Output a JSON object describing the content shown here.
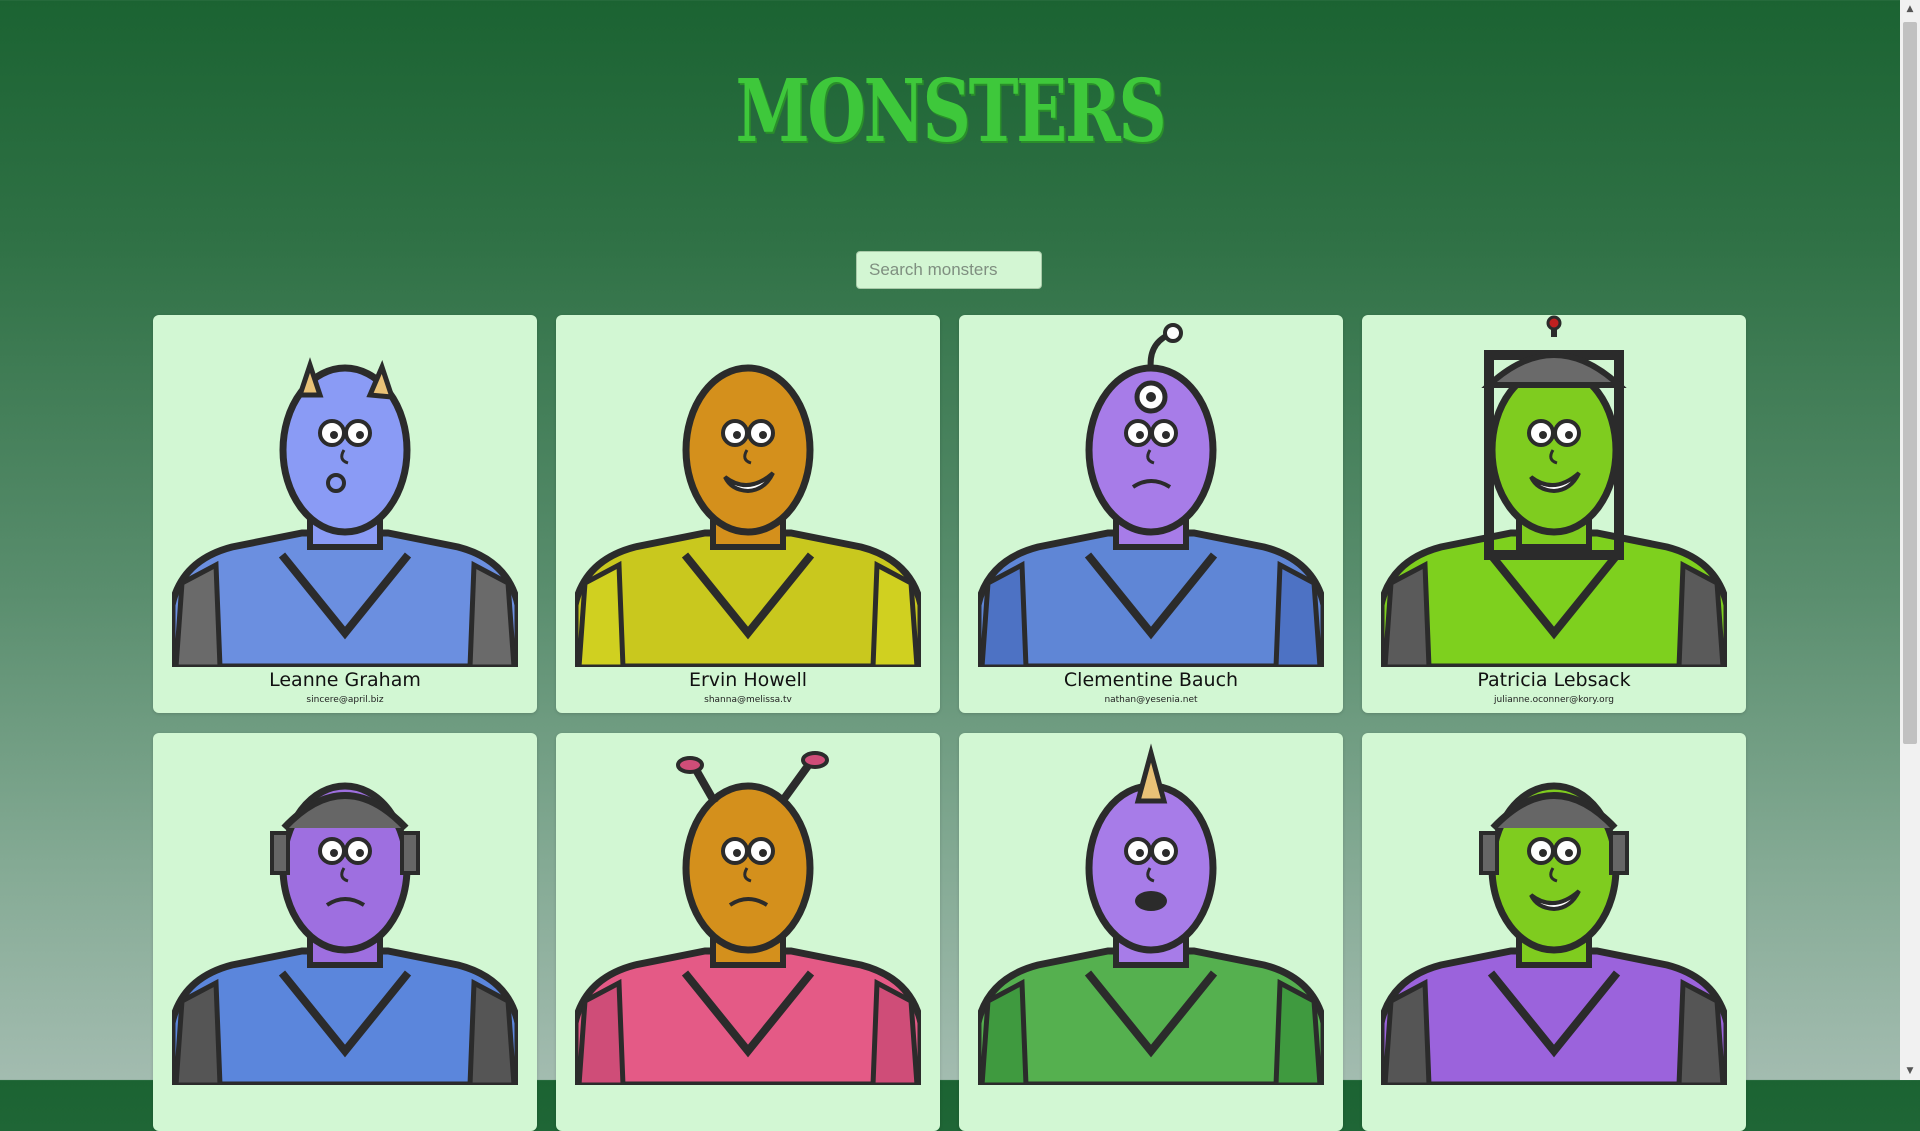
{
  "header": {
    "title": "MONSTERS"
  },
  "search": {
    "placeholder": "Search monsters",
    "value": ""
  },
  "monsters": [
    {
      "name": "Leanne Graham",
      "email": "sincere@april.biz",
      "skin": "#8a9bf5",
      "body": "#6b8fe0",
      "armor": "#6a6a6a",
      "head": "horns",
      "mouth": "pucker"
    },
    {
      "name": "Ervin Howell",
      "email": "shanna@melissa.tv",
      "skin": "#d4901c",
      "body": "#c9c81e",
      "armor": "#d0d020",
      "head": "helmet",
      "mouth": "grin"
    },
    {
      "name": "Clementine Bauch",
      "email": "nathan@yesenia.net",
      "skin": "#a77ce8",
      "body": "#5f86d6",
      "armor": "#4d72c4",
      "head": "antenna",
      "mouth": "frown"
    },
    {
      "name": "Patricia Lebsack",
      "email": "julianne.oconner@kory.org",
      "skin": "#7fcc1f",
      "body": "#7ed01e",
      "armor": "#5a5a5a",
      "head": "helmet-tall",
      "mouth": "grin"
    },
    {
      "name": "",
      "email": "",
      "skin": "#9e6fe0",
      "body": "#5b86dc",
      "armor": "#555555",
      "head": "robot",
      "mouth": "frown"
    },
    {
      "name": "",
      "email": "",
      "skin": "#d4901c",
      "body": "#e45a86",
      "armor": "#cf4d78",
      "head": "antennae",
      "mouth": "frown"
    },
    {
      "name": "",
      "email": "",
      "skin": "#a77ce8",
      "body": "#55b04f",
      "armor": "#3f9a3f",
      "head": "horn",
      "mouth": "open"
    },
    {
      "name": "",
      "email": "",
      "skin": "#7fcc1f",
      "body": "#9b63dc",
      "armor": "#555555",
      "head": "robot",
      "mouth": "grin"
    }
  ]
}
